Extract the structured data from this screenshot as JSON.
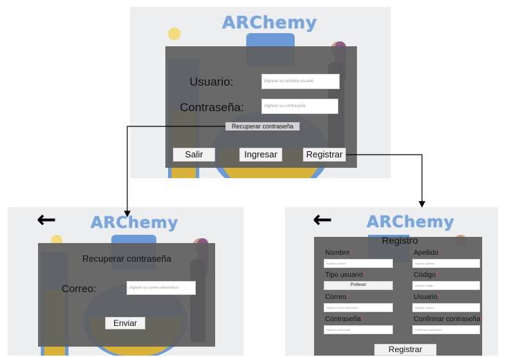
{
  "app_name": "ARChemy",
  "login": {
    "user_label": "Usuario:",
    "user_placeholder": "Ingrese su nombre usuario",
    "password_label": "Contraseña:",
    "password_placeholder": "Ingrese su contraseña",
    "recover_link": "Recuperar contraseña",
    "exit_button": "Salir",
    "login_button": "Ingresar",
    "register_button": "Registrar"
  },
  "recover": {
    "title": "Recuperar contraseña",
    "email_label": "Correo:",
    "email_placeholder": "Ingrese su correo electrónico",
    "send_button": "Enviar"
  },
  "register": {
    "title": "Registro",
    "name_label": "Nombre",
    "name_placeholder": "Ingrese nombre",
    "lastname_label": "Apellido",
    "lastname_placeholder": "Ingrese apellido",
    "user_type_label": "Tipo usuario",
    "user_type_value": "Profesor",
    "code_label": "Código",
    "code_placeholder": "Ingrese código",
    "email_label": "Correo",
    "email_placeholder": "Ingrese correo electrónico",
    "username_label": "Usuario",
    "username_placeholder": "Ingrese usuario",
    "password_label": "Contraseña",
    "password_placeholder": "Ingrese contraseña",
    "confirm_label": "Confirmar contraseña",
    "confirm_placeholder": "Confirmar contraseña",
    "required_mark": "*",
    "submit_button": "Registrar"
  },
  "icons": {
    "back": "arrow-left-icon"
  },
  "colors": {
    "logo": "#7aa6dc",
    "panel": "#5f5f5f",
    "flask": "#6c9ad6",
    "liquid": "#d9b23a",
    "required": "#e0494b"
  }
}
